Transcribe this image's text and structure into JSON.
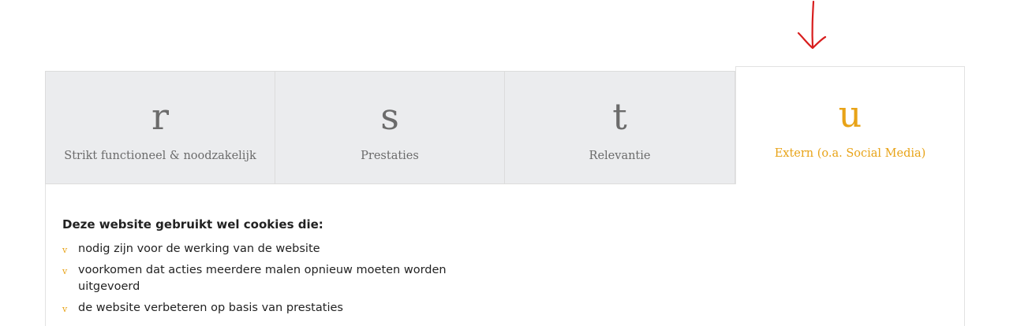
{
  "tabs": [
    {
      "glyph": "r",
      "label": "Strikt functioneel & noodzakelijk",
      "active": false
    },
    {
      "glyph": "s",
      "label": "Prestaties",
      "active": false
    },
    {
      "glyph": "t",
      "label": "Relevantie",
      "active": false
    },
    {
      "glyph": "u",
      "label": "Extern (o.a. Social Media)",
      "active": true
    }
  ],
  "content": {
    "heading": "Deze website gebruikt wel cookies die:",
    "bullet_glyph": "v",
    "items": [
      "nodig zijn voor de werking van de website",
      "voorkomen dat acties meerdere malen opnieuw moeten worden uitgevoerd",
      "de website verbeteren op basis van prestaties"
    ]
  },
  "colors": {
    "accent": "#e8a317",
    "tab_bg": "#ebecee",
    "tab_text": "#6b6b6b",
    "annotation_arrow": "#d81e1e"
  },
  "annotation": {
    "icon": "down-arrow-icon"
  }
}
